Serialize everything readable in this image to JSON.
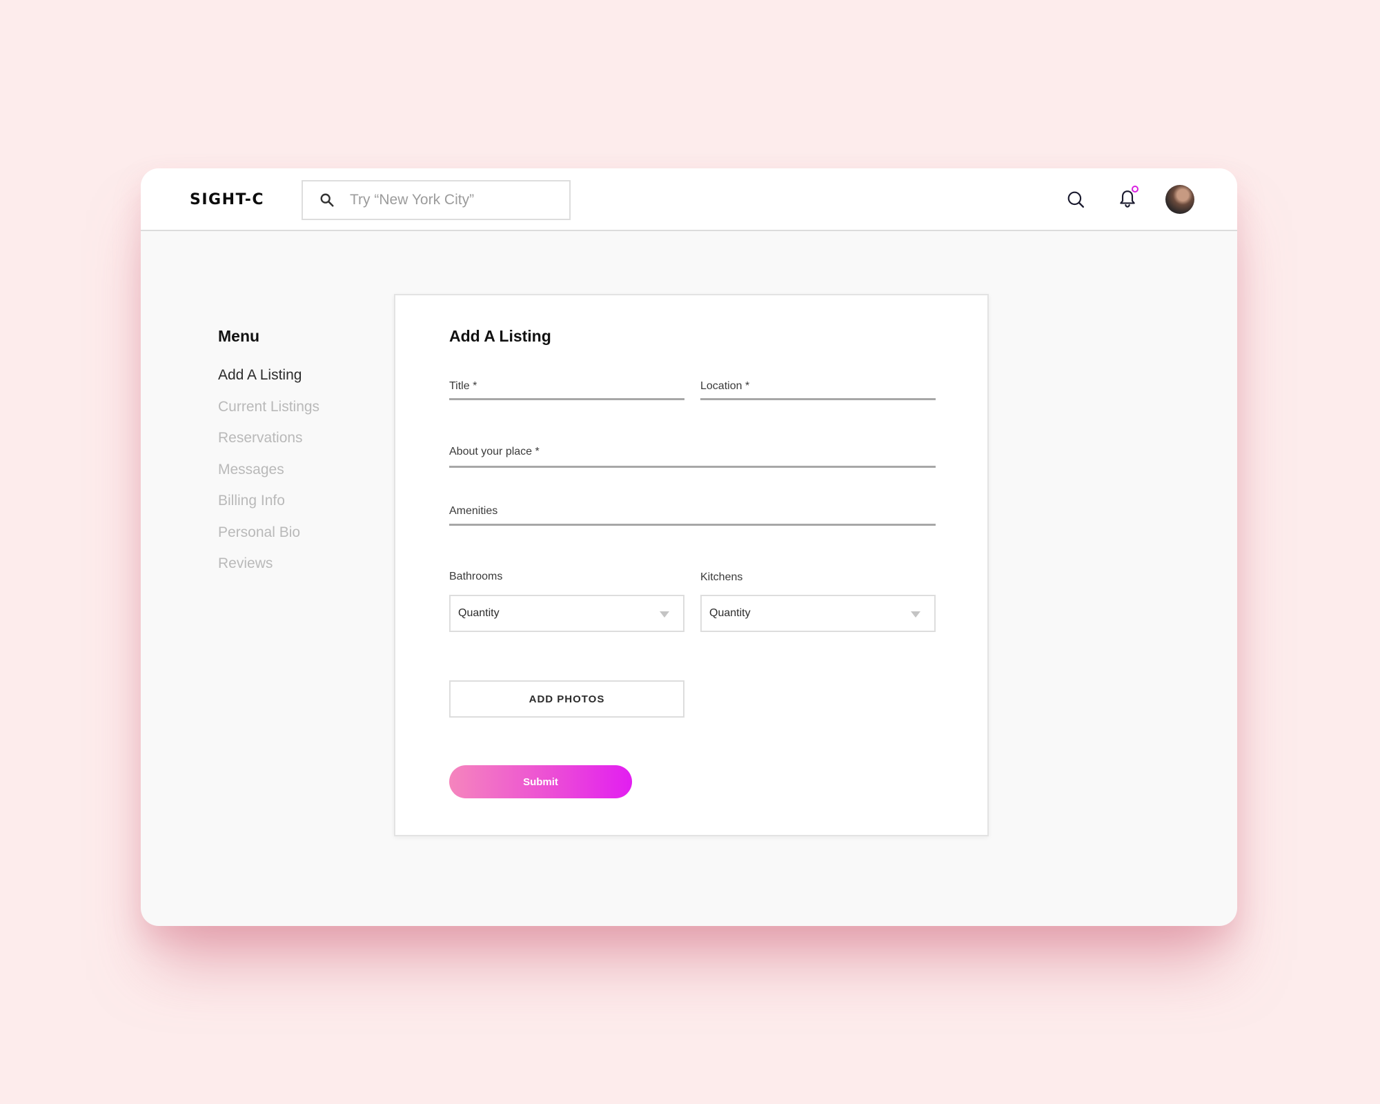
{
  "header": {
    "brand": "SIGHT-C",
    "search_placeholder": "Try “New York City”",
    "accent_color": "#d81ee0"
  },
  "sidebar": {
    "title": "Menu",
    "items": [
      {
        "label": "Add A Listing",
        "active": true
      },
      {
        "label": "Current Listings",
        "active": false
      },
      {
        "label": "Reservations",
        "active": false
      },
      {
        "label": "Messages",
        "active": false
      },
      {
        "label": "Billing Info",
        "active": false
      },
      {
        "label": "Personal Bio",
        "active": false
      },
      {
        "label": "Reviews",
        "active": false
      }
    ]
  },
  "form": {
    "title": "Add A Listing",
    "title_field_label": "Title *",
    "location_field_label": "Location *",
    "about_field_label": "About your place *",
    "amenities_field_label": "Amenities",
    "bathrooms": {
      "label": "Bathrooms",
      "selected": "Quantity"
    },
    "kitchens": {
      "label": "Kitchens",
      "selected": "Quantity"
    },
    "add_photos_label": "ADD PHOTOS",
    "submit_label": "Submit"
  },
  "colors": {
    "background": "#fdecec",
    "submit_gradient_start": "#f585bd",
    "submit_gradient_end": "#e21ef1"
  },
  "icons": {
    "search": "search-icon",
    "bell": "bell-icon",
    "avatar": "user-avatar"
  }
}
